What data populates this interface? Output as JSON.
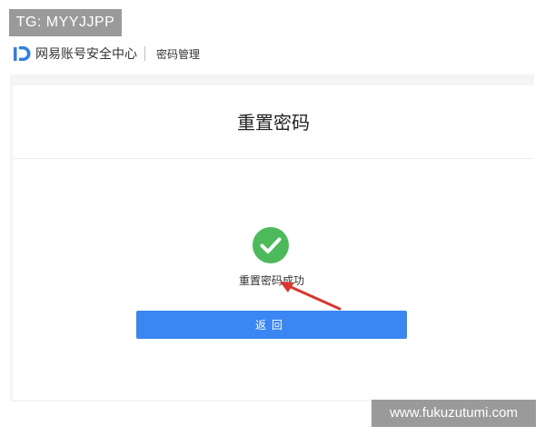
{
  "overlay": {
    "tg_badge": "TG: MYYJJPP",
    "watermark": "www.fukuzutumi.com"
  },
  "header": {
    "logo_icon": "netease-id-logo-icon",
    "brand_name": "网易账号安全中心",
    "nav_link": "密码管理"
  },
  "card": {
    "title": "重置密码",
    "success_icon": "check-circle-icon",
    "success_message": "重置密码成功",
    "return_button_label": "返回"
  },
  "colors": {
    "accent_blue": "#3a86f2",
    "success_green": "#4cba5a",
    "annotation_red": "#d9362e",
    "logo_blue": "#2f7fe6"
  }
}
